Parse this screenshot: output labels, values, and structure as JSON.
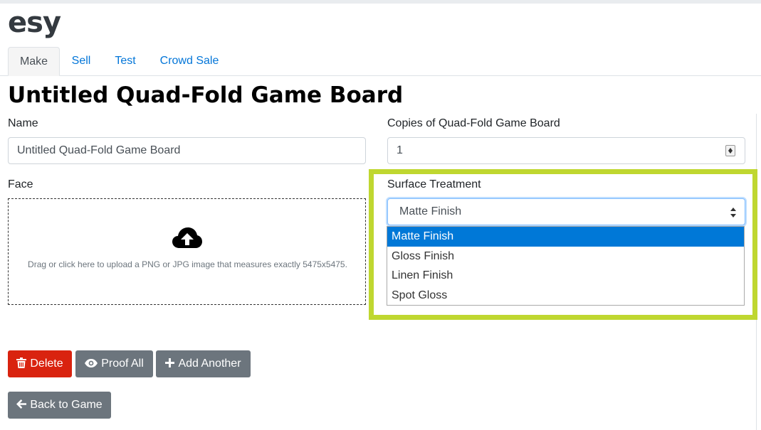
{
  "brand": "esy",
  "tabs": [
    {
      "label": "Make",
      "active": true
    },
    {
      "label": "Sell",
      "active": false
    },
    {
      "label": "Test",
      "active": false
    },
    {
      "label": "Crowd Sale",
      "active": false
    }
  ],
  "page_title": "Untitled Quad-Fold Game Board",
  "form": {
    "name_label": "Name",
    "name_value": "Untitled Quad-Fold Game Board",
    "copies_label": "Copies of Quad-Fold Game Board",
    "copies_value": "1",
    "face_label": "Face",
    "face_hint": "Drag or click here to upload a PNG or JPG image that measures exactly 5475x5475.",
    "surface_label": "Surface Treatment",
    "surface_selected": "Matte Finish",
    "surface_options": [
      "Matte Finish",
      "Gloss Finish",
      "Linen Finish",
      "Spot Gloss"
    ]
  },
  "buttons": {
    "delete": "Delete",
    "proof_all": "Proof All",
    "add_another": "Add Another",
    "back": "Back to Game"
  },
  "colors": {
    "accent": "#0275d8",
    "danger": "#d9230f",
    "secondary": "#6c757d",
    "highlight": "#bfd730",
    "selected_option": "#0078d7"
  },
  "icons": {
    "upload": "cloud-upload-icon",
    "delete": "trash-icon",
    "proof": "eye-icon",
    "add": "plus-icon",
    "back": "arrow-left-icon"
  }
}
